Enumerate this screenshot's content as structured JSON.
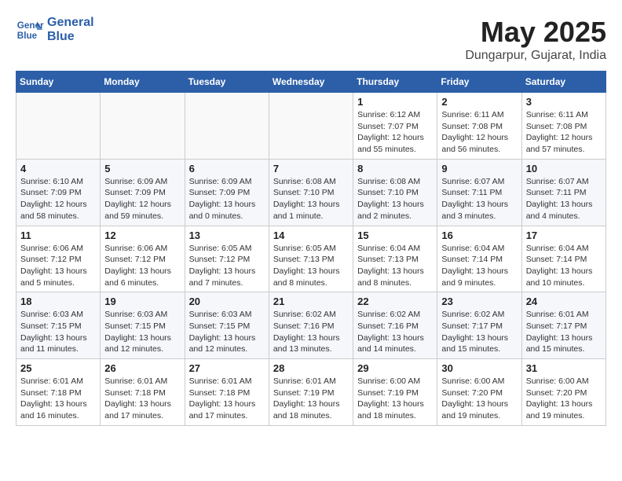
{
  "header": {
    "logo_line1": "General",
    "logo_line2": "Blue",
    "month_year": "May 2025",
    "location": "Dungarpur, Gujarat, India"
  },
  "weekdays": [
    "Sunday",
    "Monday",
    "Tuesday",
    "Wednesday",
    "Thursday",
    "Friday",
    "Saturday"
  ],
  "weeks": [
    [
      {
        "day": "",
        "info": ""
      },
      {
        "day": "",
        "info": ""
      },
      {
        "day": "",
        "info": ""
      },
      {
        "day": "",
        "info": ""
      },
      {
        "day": "1",
        "info": "Sunrise: 6:12 AM\nSunset: 7:07 PM\nDaylight: 12 hours and 55 minutes."
      },
      {
        "day": "2",
        "info": "Sunrise: 6:11 AM\nSunset: 7:08 PM\nDaylight: 12 hours and 56 minutes."
      },
      {
        "day": "3",
        "info": "Sunrise: 6:11 AM\nSunset: 7:08 PM\nDaylight: 12 hours and 57 minutes."
      }
    ],
    [
      {
        "day": "4",
        "info": "Sunrise: 6:10 AM\nSunset: 7:09 PM\nDaylight: 12 hours and 58 minutes."
      },
      {
        "day": "5",
        "info": "Sunrise: 6:09 AM\nSunset: 7:09 PM\nDaylight: 12 hours and 59 minutes."
      },
      {
        "day": "6",
        "info": "Sunrise: 6:09 AM\nSunset: 7:09 PM\nDaylight: 13 hours and 0 minutes."
      },
      {
        "day": "7",
        "info": "Sunrise: 6:08 AM\nSunset: 7:10 PM\nDaylight: 13 hours and 1 minute."
      },
      {
        "day": "8",
        "info": "Sunrise: 6:08 AM\nSunset: 7:10 PM\nDaylight: 13 hours and 2 minutes."
      },
      {
        "day": "9",
        "info": "Sunrise: 6:07 AM\nSunset: 7:11 PM\nDaylight: 13 hours and 3 minutes."
      },
      {
        "day": "10",
        "info": "Sunrise: 6:07 AM\nSunset: 7:11 PM\nDaylight: 13 hours and 4 minutes."
      }
    ],
    [
      {
        "day": "11",
        "info": "Sunrise: 6:06 AM\nSunset: 7:12 PM\nDaylight: 13 hours and 5 minutes."
      },
      {
        "day": "12",
        "info": "Sunrise: 6:06 AM\nSunset: 7:12 PM\nDaylight: 13 hours and 6 minutes."
      },
      {
        "day": "13",
        "info": "Sunrise: 6:05 AM\nSunset: 7:12 PM\nDaylight: 13 hours and 7 minutes."
      },
      {
        "day": "14",
        "info": "Sunrise: 6:05 AM\nSunset: 7:13 PM\nDaylight: 13 hours and 8 minutes."
      },
      {
        "day": "15",
        "info": "Sunrise: 6:04 AM\nSunset: 7:13 PM\nDaylight: 13 hours and 8 minutes."
      },
      {
        "day": "16",
        "info": "Sunrise: 6:04 AM\nSunset: 7:14 PM\nDaylight: 13 hours and 9 minutes."
      },
      {
        "day": "17",
        "info": "Sunrise: 6:04 AM\nSunset: 7:14 PM\nDaylight: 13 hours and 10 minutes."
      }
    ],
    [
      {
        "day": "18",
        "info": "Sunrise: 6:03 AM\nSunset: 7:15 PM\nDaylight: 13 hours and 11 minutes."
      },
      {
        "day": "19",
        "info": "Sunrise: 6:03 AM\nSunset: 7:15 PM\nDaylight: 13 hours and 12 minutes."
      },
      {
        "day": "20",
        "info": "Sunrise: 6:03 AM\nSunset: 7:15 PM\nDaylight: 13 hours and 12 minutes."
      },
      {
        "day": "21",
        "info": "Sunrise: 6:02 AM\nSunset: 7:16 PM\nDaylight: 13 hours and 13 minutes."
      },
      {
        "day": "22",
        "info": "Sunrise: 6:02 AM\nSunset: 7:16 PM\nDaylight: 13 hours and 14 minutes."
      },
      {
        "day": "23",
        "info": "Sunrise: 6:02 AM\nSunset: 7:17 PM\nDaylight: 13 hours and 15 minutes."
      },
      {
        "day": "24",
        "info": "Sunrise: 6:01 AM\nSunset: 7:17 PM\nDaylight: 13 hours and 15 minutes."
      }
    ],
    [
      {
        "day": "25",
        "info": "Sunrise: 6:01 AM\nSunset: 7:18 PM\nDaylight: 13 hours and 16 minutes."
      },
      {
        "day": "26",
        "info": "Sunrise: 6:01 AM\nSunset: 7:18 PM\nDaylight: 13 hours and 17 minutes."
      },
      {
        "day": "27",
        "info": "Sunrise: 6:01 AM\nSunset: 7:18 PM\nDaylight: 13 hours and 17 minutes."
      },
      {
        "day": "28",
        "info": "Sunrise: 6:01 AM\nSunset: 7:19 PM\nDaylight: 13 hours and 18 minutes."
      },
      {
        "day": "29",
        "info": "Sunrise: 6:00 AM\nSunset: 7:19 PM\nDaylight: 13 hours and 18 minutes."
      },
      {
        "day": "30",
        "info": "Sunrise: 6:00 AM\nSunset: 7:20 PM\nDaylight: 13 hours and 19 minutes."
      },
      {
        "day": "31",
        "info": "Sunrise: 6:00 AM\nSunset: 7:20 PM\nDaylight: 13 hours and 19 minutes."
      }
    ]
  ]
}
